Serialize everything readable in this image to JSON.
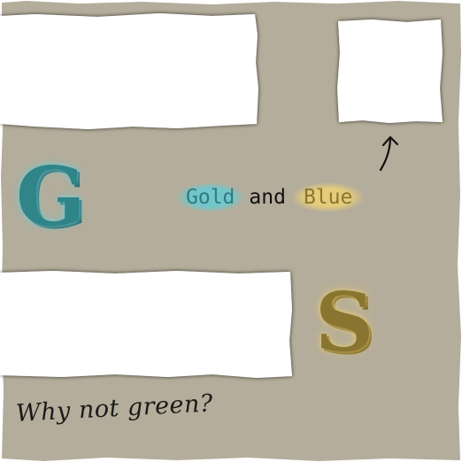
{
  "colors": {
    "background": "#ffffff",
    "panel": "#b5ad9b",
    "teal": "#2f8588",
    "gold": "#8a7530"
  },
  "letters": {
    "first": "G",
    "second": "S"
  },
  "phrase": {
    "word1": "Gold",
    "word2": "and",
    "word3": "Blue"
  },
  "note": "Why not green?",
  "icons": {
    "arrow": "curved-arrow-up-icon"
  }
}
